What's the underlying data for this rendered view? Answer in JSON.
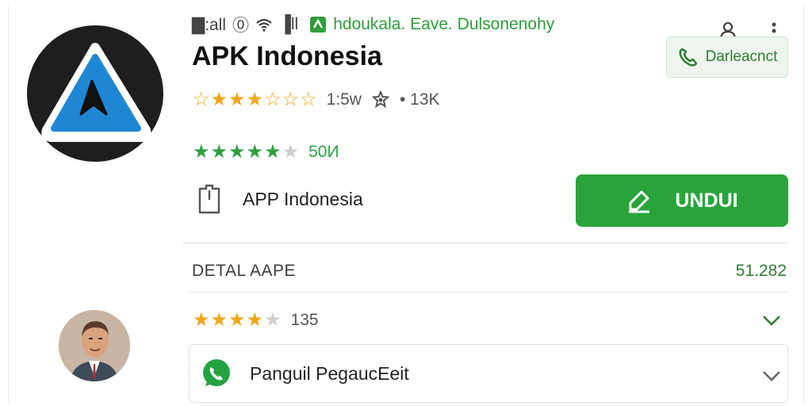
{
  "status_bar": {
    "signal_text": "▇:all",
    "clock_icon_text": "⓪",
    "signal_bars": "▐ll",
    "notification": "hdoukala. Eave. Dulsonenohy"
  },
  "app": {
    "title": "APK Indonesia",
    "rating_main": {
      "stars": 3.5,
      "text": "1:5w"
    },
    "badge_text": "• 13K",
    "rating_secondary": {
      "stars": 4.5,
      "text": "50И"
    },
    "developer": "APP Indonesia"
  },
  "buttons": {
    "download_small": "Darleacnct",
    "download_main": "UNDUI"
  },
  "details": {
    "heading": "DETAL AAPE",
    "number": "51.282",
    "review": {
      "stars": 4,
      "count": "135"
    },
    "whatsapp_label": "Panguil PegaucEeit"
  },
  "colors": {
    "accent_green": "#2aa43a",
    "star_orange": "#f2a516",
    "app_icon_blue": "#1e87d4"
  },
  "icons": [
    "person-icon",
    "more-vert-icon",
    "phone-icon",
    "edit-icon",
    "file-icon",
    "whatsapp-icon",
    "chevron-down-icon",
    "settings-icon"
  ]
}
